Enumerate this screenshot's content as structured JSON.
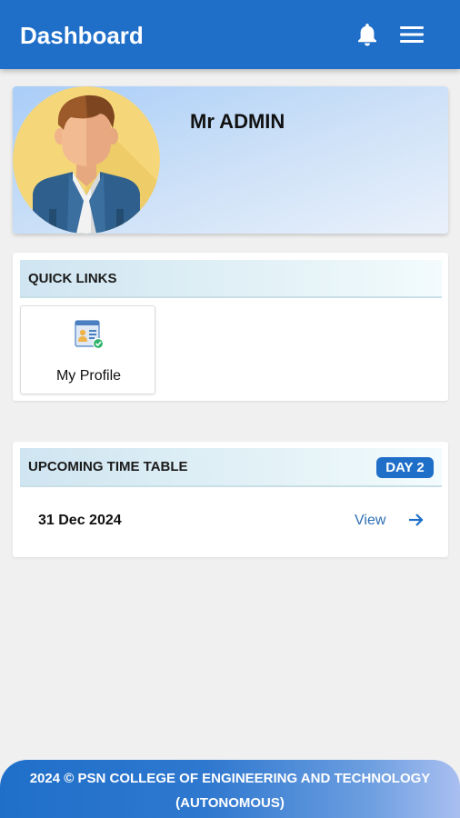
{
  "header": {
    "title": "Dashboard",
    "notification_icon": "bell-icon",
    "menu_icon": "hamburger-menu-icon"
  },
  "profile": {
    "name": "Mr ADMIN",
    "avatar_icon": "user-avatar-illustration"
  },
  "quick_links": {
    "title": "QUICK LINKS",
    "items": [
      {
        "label": "My Profile",
        "icon": "profile-card-icon"
      }
    ]
  },
  "timetable": {
    "title": "UPCOMING TIME TABLE",
    "day_badge": "DAY 2",
    "date": "31 Dec 2024",
    "view_label": "View",
    "arrow_icon": "arrow-right-icon"
  },
  "footer": {
    "line1": "2024 © PSN COLLEGE OF ENGINEERING AND TECHNOLOGY",
    "line2": "(AUTONOMOUS)"
  },
  "colors": {
    "primary": "#1f6fc9",
    "link": "#2d6fb3",
    "background": "#f0f0f0"
  }
}
